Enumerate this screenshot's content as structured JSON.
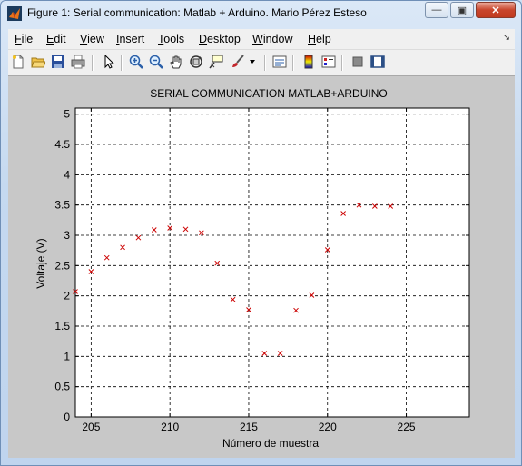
{
  "window": {
    "title": "Figure 1: Serial communication: Matlab + Arduino. Mario Pérez Esteso",
    "icon": "matlab-logo-icon",
    "minimize_icon": "minimize-icon",
    "restore_icon": "restore-icon",
    "close_icon": "close-icon"
  },
  "menubar": {
    "items": [
      {
        "underline": "F",
        "rest": "ile"
      },
      {
        "underline": "E",
        "rest": "dit"
      },
      {
        "underline": "V",
        "rest": "iew"
      },
      {
        "underline": "I",
        "rest": "nsert"
      },
      {
        "underline": "T",
        "rest": "ools"
      },
      {
        "underline": "D",
        "rest": "esktop"
      },
      {
        "underline": "W",
        "rest": "indow"
      },
      {
        "underline": "H",
        "rest": "elp"
      }
    ]
  },
  "toolbar": {
    "icons": [
      "new-figure-icon",
      "open-file-icon",
      "save-icon",
      "print-icon",
      "pointer-icon",
      "zoom-in-icon",
      "zoom-out-icon",
      "pan-hand-icon",
      "rotate-3d-icon",
      "data-cursor-icon",
      "brush-icon",
      "link-plot-icon",
      "colorbar-icon",
      "legend-icon",
      "hide-plot-tools-icon",
      "show-plot-tools-icon"
    ]
  },
  "chart_data": {
    "type": "scatter",
    "title": "SERIAL COMMUNICATION MATLAB+ARDUINO",
    "xlabel": "Número de muestra",
    "ylabel": "Voltaje (V)",
    "xlim": [
      204,
      229
    ],
    "ylim": [
      0,
      5.1
    ],
    "xticks": [
      205,
      210,
      215,
      220,
      225
    ],
    "yticks": [
      0,
      0.5,
      1,
      1.5,
      2,
      2.5,
      3,
      3.5,
      4,
      4.5,
      5
    ],
    "grid": true,
    "marker": "x",
    "marker_color": "#cc0000",
    "series": [
      {
        "x": [
          204,
          205,
          206,
          207,
          208,
          209,
          210,
          211,
          212,
          213,
          214,
          215,
          216,
          217,
          218,
          219,
          220,
          221,
          222,
          223,
          224
        ],
        "y": [
          2.07,
          2.4,
          2.63,
          2.8,
          2.96,
          3.09,
          3.12,
          3.1,
          3.04,
          2.54,
          1.94,
          1.77,
          1.05,
          1.05,
          1.76,
          2.01,
          2.76,
          3.36,
          3.5,
          3.48,
          3.48
        ]
      }
    ]
  }
}
